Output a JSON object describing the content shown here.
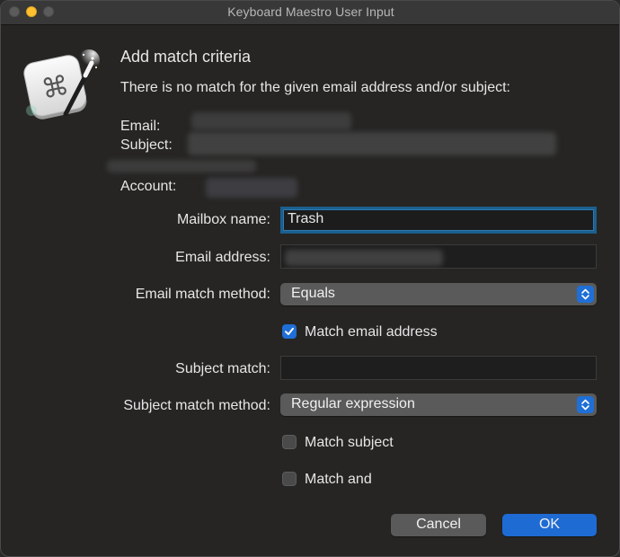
{
  "window": {
    "title": "Keyboard Maestro User Input"
  },
  "app_icon": "keyboard-maestro-app-icon",
  "dialog": {
    "heading": "Add match criteria",
    "message": "There is no match for the given email address and/or subject:",
    "info": {
      "email_label": "Email:",
      "subject_label": "Subject:",
      "account_label": "Account:"
    }
  },
  "form": {
    "mailbox_name": {
      "label": "Mailbox name:",
      "value": "Trash"
    },
    "email_address": {
      "label": "Email address:",
      "value": ""
    },
    "email_match_method": {
      "label": "Email match method:",
      "selected": "Equals"
    },
    "match_email_address": {
      "label": "Match email address",
      "checked": true
    },
    "subject_match": {
      "label": "Subject match:",
      "value": ""
    },
    "subject_match_method": {
      "label": "Subject match method:",
      "selected": "Regular expression"
    },
    "match_subject": {
      "label": "Match subject",
      "checked": false
    },
    "match_and": {
      "label": "Match and",
      "checked": false
    }
  },
  "buttons": {
    "cancel": "Cancel",
    "ok": "OK"
  },
  "colors": {
    "background": "#262523",
    "titlebar": "#383838",
    "accent": "#1e6bd4",
    "focus_ring": "#1c5f8e",
    "minimize_button": "#fec02f"
  }
}
